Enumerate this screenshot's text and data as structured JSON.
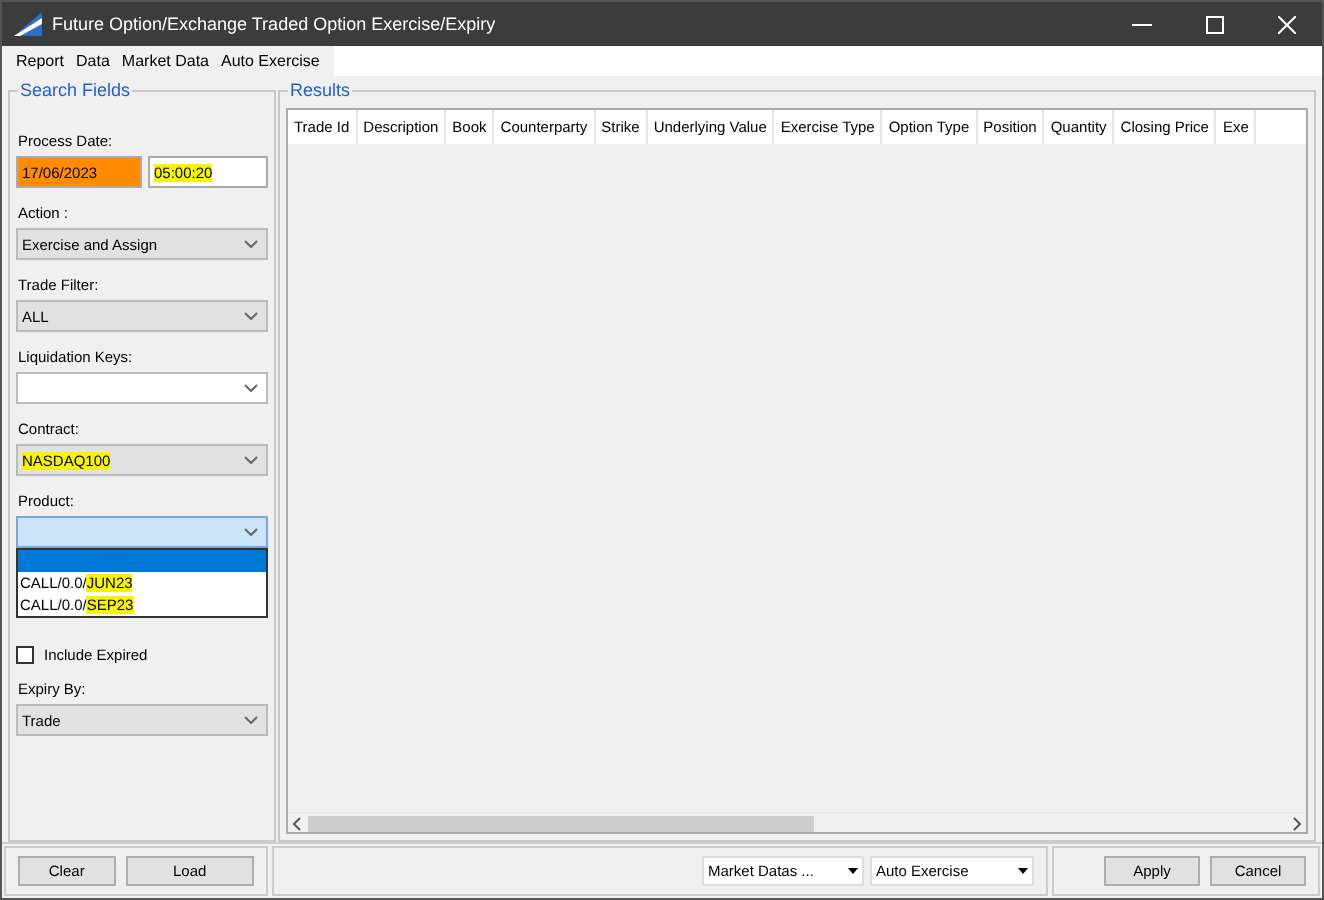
{
  "window": {
    "title": "Future Option/Exchange Traded Option Exercise/Expiry"
  },
  "menu": [
    "Report",
    "Data",
    "Market Data",
    "Auto Exercise"
  ],
  "search_fields": {
    "title": "Search Fields",
    "process_date": {
      "label": "Process Date:",
      "date": "17/06/2023",
      "time": "05:00:20",
      "date_highlighted": true,
      "time_highlighted": true
    },
    "combos": [
      {
        "label": "Action :",
        "value": "Exercise and Assign",
        "highlighted": false,
        "kind": "grey"
      },
      {
        "label": "Trade Filter:",
        "value": "ALL",
        "highlighted": false,
        "kind": "grey"
      },
      {
        "label": "Liquidation Keys:",
        "kind": "white"
      },
      {
        "label": "Contract:",
        "value": "NASDAQ100",
        "highlighted": true,
        "kind": "grey"
      },
      {
        "label": "Product:",
        "kind": "open"
      }
    ],
    "product_options": [
      {
        "prefix": "CALL/0.0/",
        "marked": "JUN23",
        "selected": false
      },
      {
        "prefix": "CALL/0.0/",
        "marked": "SEP23",
        "selected": false
      }
    ],
    "include_expired": {
      "label": "Include Expired",
      "checked": false
    },
    "expiry_by": {
      "label": "Expiry By:",
      "value": "Trade"
    }
  },
  "results": {
    "title": "Results",
    "columns": [
      "Trade Id",
      "Description",
      "Book",
      "Counterparty",
      "Strike",
      "Underlying Value",
      "Exercise Type",
      "Option Type",
      "Position",
      "Quantity",
      "Closing Price",
      "Exe"
    ]
  },
  "bottom": {
    "left_buttons": [
      "Clear",
      "Load"
    ],
    "dropdowns": [
      "Market Datas ...",
      "Auto Exercise"
    ],
    "right_buttons": [
      "Apply",
      "Cancel"
    ]
  }
}
